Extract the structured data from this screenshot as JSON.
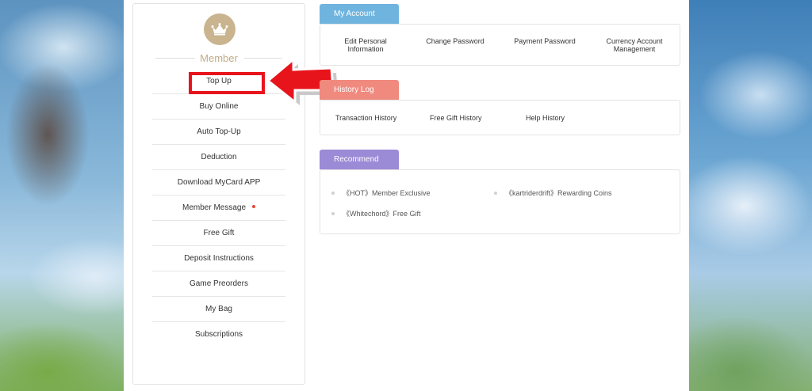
{
  "sidebar": {
    "title": "Member",
    "items": [
      {
        "label": "Top Up"
      },
      {
        "label": "Buy Online"
      },
      {
        "label": "Auto Top-Up"
      },
      {
        "label": "Deduction"
      },
      {
        "label": "Download MyCard APP"
      },
      {
        "label": "Member Message"
      },
      {
        "label": "Free Gift"
      },
      {
        "label": "Deposit Instructions"
      },
      {
        "label": "Game Preorders"
      },
      {
        "label": "My Bag"
      },
      {
        "label": "Subscriptions"
      }
    ]
  },
  "my_account": {
    "tab_label": "My Account",
    "items": [
      {
        "label": "Edit Personal\nInformation"
      },
      {
        "label": "Change Password"
      },
      {
        "label": "Payment Password"
      },
      {
        "label": "Currency Account\nManagement"
      }
    ]
  },
  "history_log": {
    "tab_label": "History Log",
    "items": [
      {
        "label": "Transaction History"
      },
      {
        "label": "Free Gift History"
      },
      {
        "label": "Help History"
      }
    ]
  },
  "recommend": {
    "tab_label": "Recommend",
    "items": [
      {
        "label": "《HOT》Member Exclusive"
      },
      {
        "label": "《kartriderdrift》Rewarding Coins"
      },
      {
        "label": "《Whitechord》Free Gift"
      }
    ]
  },
  "colors": {
    "tab_account": "#6fb4de",
    "tab_history": "#f0897e",
    "tab_recommend": "#9b8ad6",
    "highlight": "#e8141c",
    "avatar": "#c9b48f",
    "notification_dot": "#e64a3b"
  },
  "icons": {
    "avatar": "crown-icon",
    "annotation": "red-arrow-icon"
  }
}
